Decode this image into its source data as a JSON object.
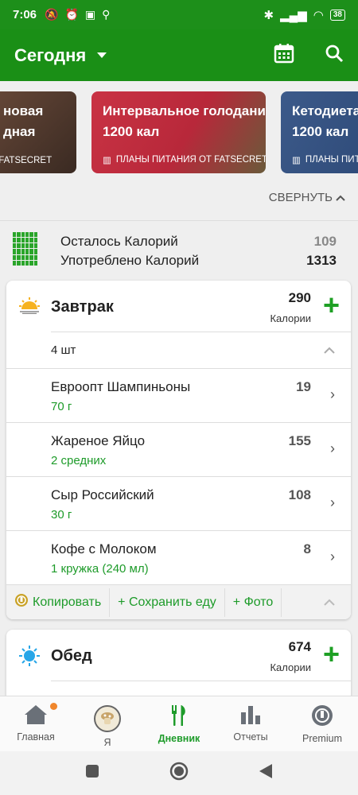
{
  "status_bar": {
    "time": "7:06",
    "battery": "38"
  },
  "app_bar": {
    "title": "Сегодня"
  },
  "promos": [
    {
      "title_line1": "новая",
      "title_line2": "дная",
      "footer": "Т FATSECRET"
    },
    {
      "title_line1": "Интервальное голодани",
      "title_line2": "1200 кал",
      "footer": "ПЛАНЫ ПИТАНИЯ ОТ FATSECRET"
    },
    {
      "title_line1": "Кетодиета",
      "title_line2": "1200 кал",
      "footer": "ПЛАНЫ ПИТ"
    }
  ],
  "collapse_label": "СВЕРНУТЬ",
  "summary": {
    "remaining_label": "Осталось Калорий",
    "remaining_value": "109",
    "consumed_label": "Употреблено Калорий",
    "consumed_value": "1313"
  },
  "breakfast": {
    "name": "Завтрак",
    "calories": "290",
    "unit": "Калории",
    "count": "4 шт",
    "items": [
      {
        "name": "Евроопт Шампиньоны",
        "qty": "70 г",
        "cal": "19"
      },
      {
        "name": "Жареное Яйцо",
        "qty": "2 средних",
        "cal": "155"
      },
      {
        "name": "Сыр Российский",
        "qty": "30 г",
        "cal": "108"
      },
      {
        "name": "Кофе с Молоком",
        "qty": "1 кружка (240 мл)",
        "cal": "8"
      }
    ],
    "actions": {
      "copy": "Копировать",
      "save": "+ Сохранить еду",
      "photo": "+ Фото"
    }
  },
  "lunch": {
    "name": "Обед",
    "calories": "674",
    "unit": "Калории"
  },
  "tabs": [
    {
      "label": "Главная"
    },
    {
      "label": "Я"
    },
    {
      "label": "Дневник"
    },
    {
      "label": "Отчеты"
    },
    {
      "label": "Premium"
    }
  ],
  "colors": {
    "brand_green": "#1a8f16",
    "accent_green": "#1e9b2a",
    "notification": "#f0862c"
  }
}
